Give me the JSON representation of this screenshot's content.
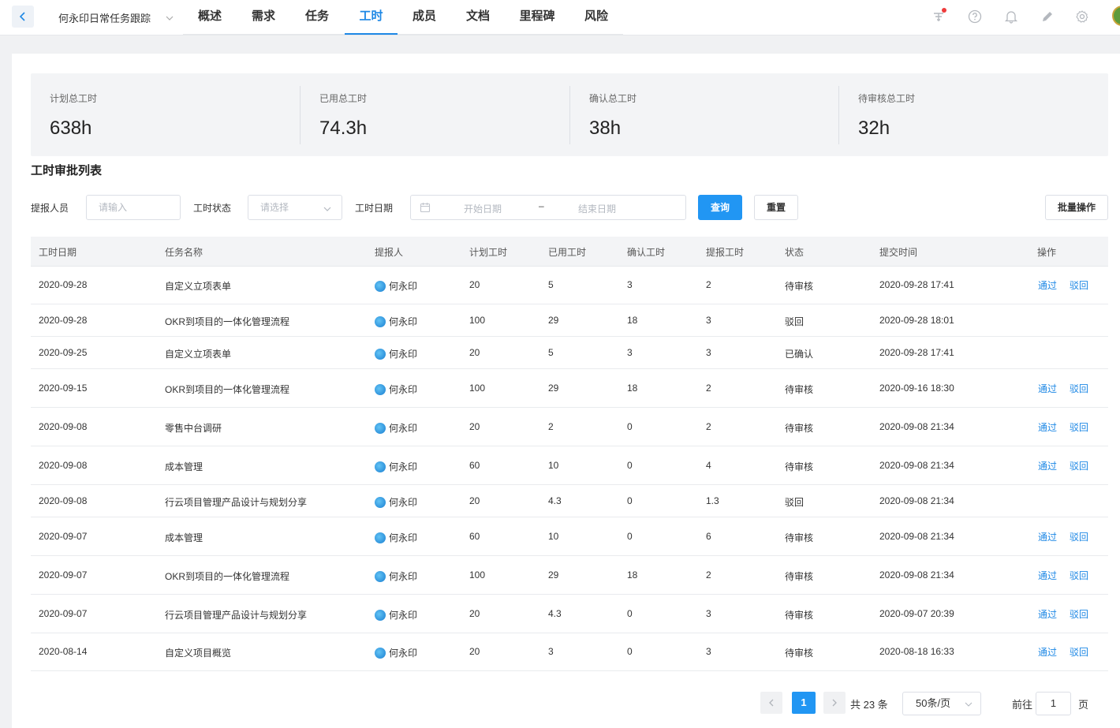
{
  "topbar": {
    "project_name": "何永印日常任务跟踪",
    "tabs": [
      "概述",
      "需求",
      "任务",
      "工时",
      "成员",
      "文档",
      "里程碑",
      "风险"
    ],
    "active_tab": "工时"
  },
  "stats": [
    {
      "label": "计划总工时",
      "value": "638h"
    },
    {
      "label": "已用总工时",
      "value": "74.3h"
    },
    {
      "label": "确认总工时",
      "value": "38h"
    },
    {
      "label": "待审核总工时",
      "value": "32h"
    }
  ],
  "section_title": "工时审批列表",
  "filters": {
    "reporter_label": "提报人员",
    "reporter_placeholder": "请输入",
    "status_label": "工时状态",
    "status_placeholder": "请选择",
    "date_label": "工时日期",
    "start_placeholder": "开始日期",
    "date_separator": "–",
    "end_placeholder": "结束日期",
    "query_button": "查询",
    "reset_button": "重置",
    "batch_button": "批量操作"
  },
  "table": {
    "headers": [
      "工时日期",
      "任务名称",
      "提报人",
      "计划工时",
      "已用工时",
      "确认工时",
      "提报工时",
      "状态",
      "提交时间",
      "操作"
    ],
    "approve_label": "通过",
    "reject_label": "驳回",
    "rows": [
      {
        "date": "2020-09-28",
        "task": "自定义立项表单",
        "reporter": "何永印",
        "planned": "20",
        "used": "5",
        "confirmed": "3",
        "reported": "2",
        "status": "待审核",
        "submitted": "2020-09-28 17:41",
        "actions": true
      },
      {
        "date": "2020-09-28",
        "task": "OKR到项目的一体化管理流程",
        "reporter": "何永印",
        "planned": "100",
        "used": "29",
        "confirmed": "18",
        "reported": "3",
        "status": "驳回",
        "submitted": "2020-09-28 18:01",
        "actions": false
      },
      {
        "date": "2020-09-25",
        "task": "自定义立项表单",
        "reporter": "何永印",
        "planned": "20",
        "used": "5",
        "confirmed": "3",
        "reported": "3",
        "status": "已确认",
        "submitted": "2020-09-28 17:41",
        "actions": false
      },
      {
        "date": "2020-09-15",
        "task": "OKR到项目的一体化管理流程",
        "reporter": "何永印",
        "planned": "100",
        "used": "29",
        "confirmed": "18",
        "reported": "2",
        "status": "待审核",
        "submitted": "2020-09-16 18:30",
        "actions": true
      },
      {
        "date": "2020-09-08",
        "task": "零售中台调研",
        "reporter": "何永印",
        "planned": "20",
        "used": "2",
        "confirmed": "0",
        "reported": "2",
        "status": "待审核",
        "submitted": "2020-09-08 21:34",
        "actions": true
      },
      {
        "date": "2020-09-08",
        "task": "成本管理",
        "reporter": "何永印",
        "planned": "60",
        "used": "10",
        "confirmed": "0",
        "reported": "4",
        "status": "待审核",
        "submitted": "2020-09-08 21:34",
        "actions": true
      },
      {
        "date": "2020-09-08",
        "task": "行云项目管理产品设计与规划分享",
        "reporter": "何永印",
        "planned": "20",
        "used": "4.3",
        "confirmed": "0",
        "reported": "1.3",
        "status": "驳回",
        "submitted": "2020-09-08 21:34",
        "actions": false
      },
      {
        "date": "2020-09-07",
        "task": "成本管理",
        "reporter": "何永印",
        "planned": "60",
        "used": "10",
        "confirmed": "0",
        "reported": "6",
        "status": "待审核",
        "submitted": "2020-09-08 21:34",
        "actions": true
      },
      {
        "date": "2020-09-07",
        "task": "OKR到项目的一体化管理流程",
        "reporter": "何永印",
        "planned": "100",
        "used": "29",
        "confirmed": "18",
        "reported": "2",
        "status": "待审核",
        "submitted": "2020-09-08 21:34",
        "actions": true
      },
      {
        "date": "2020-09-07",
        "task": "行云项目管理产品设计与规划分享",
        "reporter": "何永印",
        "planned": "20",
        "used": "4.3",
        "confirmed": "0",
        "reported": "3",
        "status": "待审核",
        "submitted": "2020-09-07 20:39",
        "actions": true
      },
      {
        "date": "2020-08-14",
        "task": "自定义项目概览",
        "reporter": "何永印",
        "planned": "20",
        "used": "3",
        "confirmed": "0",
        "reported": "3",
        "status": "待审核",
        "submitted": "2020-08-18 16:33",
        "actions": true
      }
    ]
  },
  "pagination": {
    "current_page": "1",
    "total_text": "共 23 条",
    "page_size": "50条/页",
    "goto_label": "前往",
    "goto_value": "1",
    "page_suffix": "页"
  }
}
